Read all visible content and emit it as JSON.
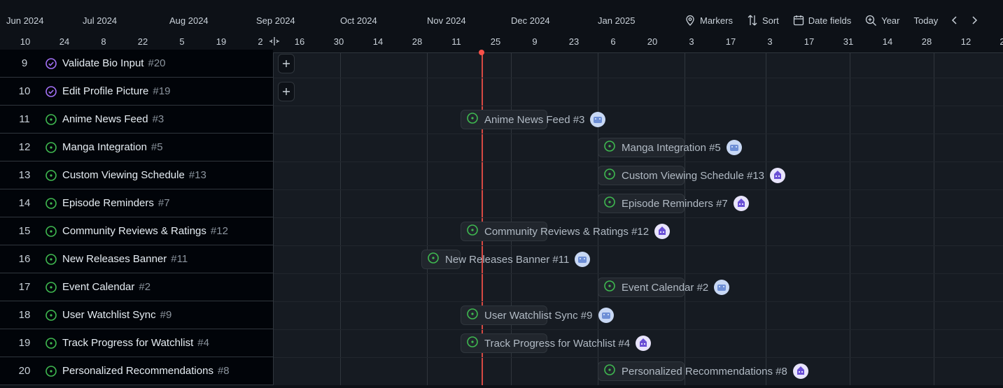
{
  "header": {
    "months": [
      "Jun 2024",
      "Jul 2024",
      "Aug 2024",
      "Sep 2024",
      "Oct 2024",
      "Nov 2024",
      "Dec 2024",
      "Jan 2025"
    ],
    "days": [
      "10",
      "24",
      "8",
      "22",
      "5",
      "19",
      "2",
      "16",
      "30",
      "14",
      "28",
      "11",
      "25",
      "9",
      "23",
      "6",
      "20",
      "3",
      "17",
      "3",
      "17",
      "31",
      "14",
      "28",
      "12",
      "2"
    ]
  },
  "toolbar": {
    "markers_label": "Markers",
    "sort_label": "Sort",
    "date_fields_label": "Date fields",
    "zoom_label": "Year",
    "today_label": "Today"
  },
  "rows": [
    {
      "num": "9",
      "title": "Validate Bio Input",
      "id": "#20",
      "status": "done"
    },
    {
      "num": "10",
      "title": "Edit Profile Picture",
      "id": "#19",
      "status": "done"
    },
    {
      "num": "11",
      "title": "Anime News Feed",
      "id": "#3",
      "status": "open"
    },
    {
      "num": "12",
      "title": "Manga Integration",
      "id": "#5",
      "status": "open"
    },
    {
      "num": "13",
      "title": "Custom Viewing Schedule",
      "id": "#13",
      "status": "open"
    },
    {
      "num": "14",
      "title": "Episode Reminders",
      "id": "#7",
      "status": "open"
    },
    {
      "num": "15",
      "title": "Community Reviews & Ratings",
      "id": "#12",
      "status": "open"
    },
    {
      "num": "16",
      "title": "New Releases Banner",
      "id": "#11",
      "status": "open"
    },
    {
      "num": "17",
      "title": "Event Calendar",
      "id": "#2",
      "status": "open"
    },
    {
      "num": "18",
      "title": "User Watchlist Sync",
      "id": "#9",
      "status": "open"
    },
    {
      "num": "19",
      "title": "Track Progress for Watchlist",
      "id": "#4",
      "status": "open"
    },
    {
      "num": "20",
      "title": "Personalized Recommendations",
      "id": "#8",
      "status": "open"
    }
  ],
  "bars": [
    {
      "label": "Anime News Feed #3",
      "avatar": "a"
    },
    {
      "label": "Manga Integration #5",
      "avatar": "a"
    },
    {
      "label": "Custom Viewing Schedule #13",
      "avatar": "b"
    },
    {
      "label": "Episode Reminders #7",
      "avatar": "b"
    },
    {
      "label": "Community Reviews & Ratings #12",
      "avatar": "b"
    },
    {
      "label": "New Releases Banner #11",
      "avatar": "a"
    },
    {
      "label": "Event Calendar #2",
      "avatar": "a"
    },
    {
      "label": "User Watchlist Sync #9",
      "avatar": "a"
    },
    {
      "label": "Track Progress for Watchlist #4",
      "avatar": "b"
    },
    {
      "label": "Personalized Recommendations #8",
      "avatar": "b"
    }
  ],
  "colors": {
    "open_status": "#3fb950",
    "done_status": "#a371f7",
    "today_marker": "#f85149"
  }
}
